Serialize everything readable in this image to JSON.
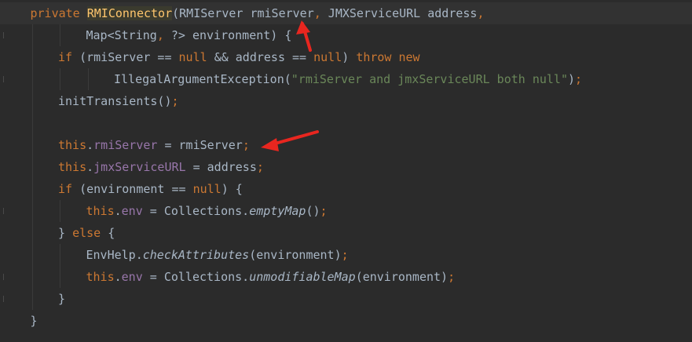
{
  "editor": {
    "lines": [
      {
        "indent": 1,
        "tokens": [
          {
            "t": "private ",
            "c": "kw"
          },
          {
            "t": "RMIConnector",
            "c": "fn-hl"
          },
          {
            "t": "(RMIServer rmiServer",
            "c": "plain"
          },
          {
            "t": ",",
            "c": "kw"
          },
          {
            "t": " JMXServiceURL address",
            "c": "plain"
          },
          {
            "t": ",",
            "c": "kw"
          }
        ]
      },
      {
        "indent": 3,
        "tokens": [
          {
            "t": "Map<String",
            "c": "plain"
          },
          {
            "t": ",",
            "c": "kw"
          },
          {
            "t": " ?> environment) {",
            "c": "plain"
          }
        ]
      },
      {
        "indent": 2,
        "tokens": [
          {
            "t": "if ",
            "c": "kw"
          },
          {
            "t": "(rmiServer == ",
            "c": "plain"
          },
          {
            "t": "null ",
            "c": "kw"
          },
          {
            "t": "&& address == ",
            "c": "plain"
          },
          {
            "t": "null",
            "c": "kw"
          },
          {
            "t": ") ",
            "c": "plain"
          },
          {
            "t": "throw new",
            "c": "kw"
          }
        ]
      },
      {
        "indent": 4,
        "tokens": [
          {
            "t": "IllegalArgumentException(",
            "c": "plain"
          },
          {
            "t": "\"rmiServer and jmxServiceURL both null\"",
            "c": "str"
          },
          {
            "t": ")",
            "c": "plain"
          },
          {
            "t": ";",
            "c": "kw"
          }
        ]
      },
      {
        "indent": 2,
        "tokens": [
          {
            "t": "initTransients()",
            "c": "plain"
          },
          {
            "t": ";",
            "c": "kw"
          }
        ]
      },
      {
        "indent": 2,
        "tokens": []
      },
      {
        "indent": 2,
        "tokens": [
          {
            "t": "this",
            "c": "kw"
          },
          {
            "t": ".",
            "c": "plain"
          },
          {
            "t": "rmiServer",
            "c": "field"
          },
          {
            "t": " = rmiServer",
            "c": "plain"
          },
          {
            "t": ";",
            "c": "kw"
          }
        ]
      },
      {
        "indent": 2,
        "tokens": [
          {
            "t": "this",
            "c": "kw"
          },
          {
            "t": ".",
            "c": "plain"
          },
          {
            "t": "jmxServiceURL",
            "c": "field"
          },
          {
            "t": " = address",
            "c": "plain"
          },
          {
            "t": ";",
            "c": "kw"
          }
        ]
      },
      {
        "indent": 2,
        "tokens": [
          {
            "t": "if ",
            "c": "kw"
          },
          {
            "t": "(environment == ",
            "c": "plain"
          },
          {
            "t": "null",
            "c": "kw"
          },
          {
            "t": ") {",
            "c": "plain"
          }
        ]
      },
      {
        "indent": 3,
        "tokens": [
          {
            "t": "this",
            "c": "kw"
          },
          {
            "t": ".",
            "c": "plain"
          },
          {
            "t": "env",
            "c": "field"
          },
          {
            "t": " = Collections.",
            "c": "plain"
          },
          {
            "t": "emptyMap",
            "c": "italic"
          },
          {
            "t": "()",
            "c": "plain"
          },
          {
            "t": ";",
            "c": "kw"
          }
        ]
      },
      {
        "indent": 2,
        "tokens": [
          {
            "t": "} ",
            "c": "plain"
          },
          {
            "t": "else ",
            "c": "kw"
          },
          {
            "t": "{",
            "c": "plain"
          }
        ]
      },
      {
        "indent": 3,
        "tokens": [
          {
            "t": "EnvHelp.",
            "c": "plain"
          },
          {
            "t": "checkAttributes",
            "c": "italic"
          },
          {
            "t": "(environment)",
            "c": "plain"
          },
          {
            "t": ";",
            "c": "kw"
          }
        ]
      },
      {
        "indent": 3,
        "tokens": [
          {
            "t": "this",
            "c": "kw"
          },
          {
            "t": ".",
            "c": "plain"
          },
          {
            "t": "env",
            "c": "field"
          },
          {
            "t": " = Collections.",
            "c": "plain"
          },
          {
            "t": "unmodifiableMap",
            "c": "italic"
          },
          {
            "t": "(environment)",
            "c": "plain"
          },
          {
            "t": ";",
            "c": "kw"
          }
        ]
      },
      {
        "indent": 2,
        "tokens": [
          {
            "t": "}",
            "c": "plain"
          }
        ]
      },
      {
        "indent": 1,
        "tokens": [
          {
            "t": "}",
            "c": "plain"
          }
        ]
      }
    ],
    "colors": {
      "background": "#2b2b2b",
      "keyword": "#cc7832",
      "method_declaration": "#ffc66d",
      "field": "#9876aa",
      "string": "#6a8759",
      "text": "#a9b7c6",
      "annotation_arrow": "#e8261f"
    },
    "annotations": [
      {
        "name": "arrow-pointing-to-rmiServer-parameter",
        "icon": "red-arrow-icon"
      },
      {
        "name": "arrow-pointing-to-this-rmiServer-assignment",
        "icon": "red-arrow-icon"
      }
    ]
  }
}
